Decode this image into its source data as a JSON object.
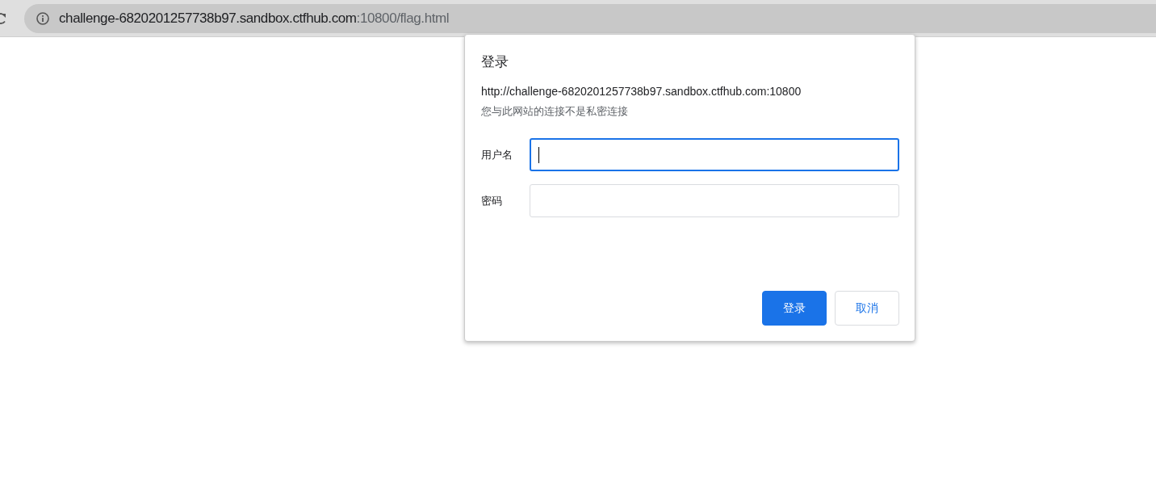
{
  "address_bar": {
    "host": "challenge-6820201257738b97.sandbox.ctfhub.com",
    "rest": ":10800/flag.html"
  },
  "dialog": {
    "title": "登录",
    "origin": "http://challenge-6820201257738b97.sandbox.ctfhub.com:10800",
    "warning": "您与此网站的连接不是私密连接",
    "fields": [
      {
        "label": "用户名",
        "focused": true
      },
      {
        "label": "密码",
        "focused": false
      }
    ],
    "buttons": [
      {
        "label": "登录",
        "kind": "primary"
      },
      {
        "label": "取消",
        "kind": "secondary"
      }
    ]
  }
}
